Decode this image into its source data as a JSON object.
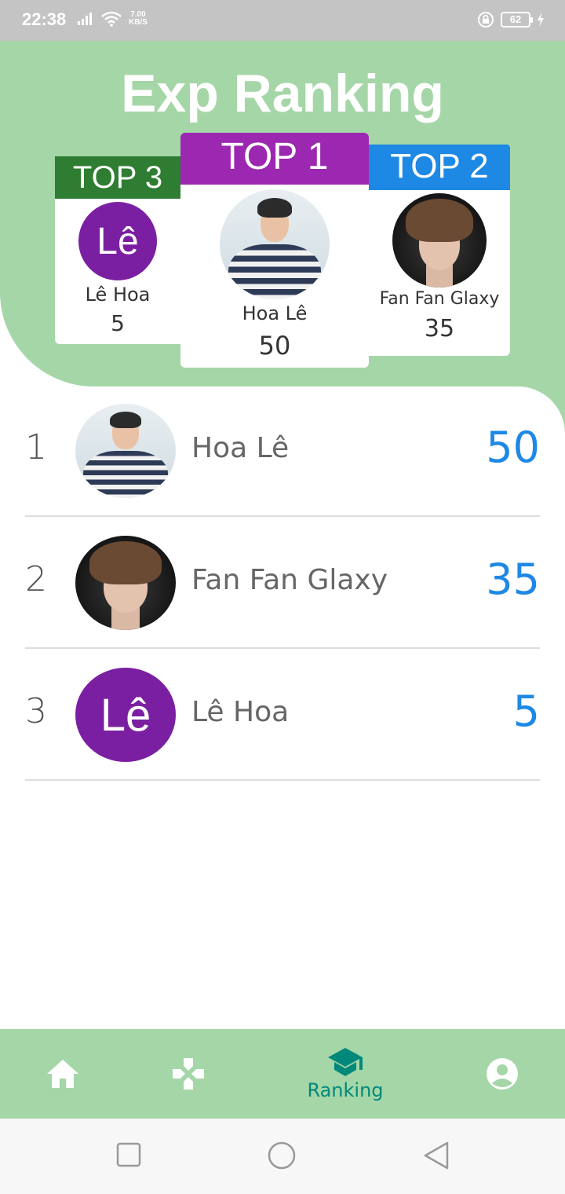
{
  "status_bar": {
    "time": "22:38",
    "net_speed_value": "7.00",
    "net_speed_unit": "KB/S",
    "battery": "62"
  },
  "header": {
    "title": "Exp Ranking"
  },
  "podium": {
    "top1": {
      "label": "TOP 1",
      "name": "Hoa Lê",
      "score": "50"
    },
    "top2": {
      "label": "TOP 2",
      "name": "Fan Fan Glaxy",
      "score": "35"
    },
    "top3": {
      "label": "TOP 3",
      "name": "Lê Hoa",
      "score": "5",
      "avatar_letter": "Lê"
    }
  },
  "ranking": [
    {
      "rank": "1",
      "name": "Hoa Lê",
      "score": "50"
    },
    {
      "rank": "2",
      "name": "Fan Fan Glaxy",
      "score": "35"
    },
    {
      "rank": "3",
      "name": "Lê Hoa",
      "score": "5",
      "avatar_letter": "Lê"
    }
  ],
  "bottom_nav": {
    "items": [
      {
        "icon": "home-icon"
      },
      {
        "icon": "gamepad-icon"
      },
      {
        "icon": "graduation-cap-icon",
        "label": "Ranking",
        "active": true
      },
      {
        "icon": "account-icon"
      }
    ]
  },
  "colors": {
    "header_green": "#a5d6a7",
    "top1_purple": "#9c27b0",
    "top2_blue": "#1e88e5",
    "top3_green": "#2e7d32",
    "score_blue": "#1e88e5",
    "active_teal": "#00897b"
  }
}
